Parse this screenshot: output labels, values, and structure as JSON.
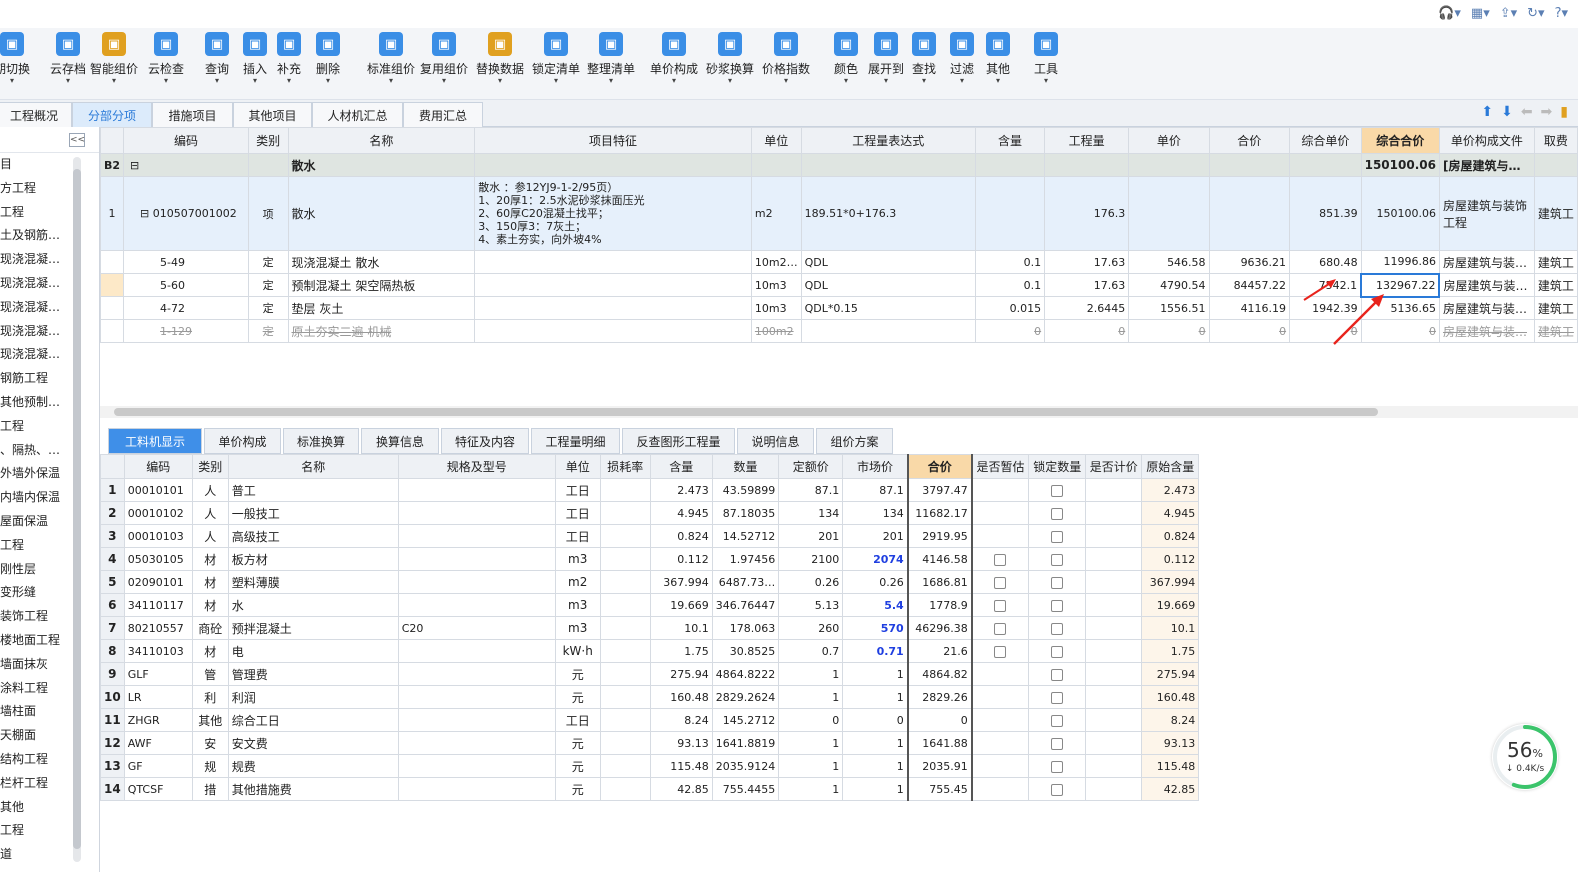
{
  "toolbar": {
    "buttons": [
      {
        "label": "期切换",
        "icon": "switch-icon",
        "color": "#3a8ee6"
      },
      {
        "label": "云存档",
        "icon": "cloud-upload-icon",
        "color": "#3a8ee6"
      },
      {
        "label": "智能组价",
        "icon": "smart-price-icon",
        "color": "#e0a020"
      },
      {
        "label": "云检查",
        "icon": "cloud-check-icon",
        "color": "#3a8ee6"
      },
      {
        "label": "查询",
        "icon": "query-icon",
        "color": "#3a8ee6"
      },
      {
        "label": "插入",
        "icon": "insert-icon",
        "color": "#3a8ee6"
      },
      {
        "label": "补充",
        "icon": "supplement-icon",
        "color": "#3a8ee6"
      },
      {
        "label": "删除",
        "icon": "delete-icon",
        "color": "#3a8ee6"
      },
      {
        "label": "标准组价",
        "icon": "standard-price-icon",
        "color": "#3a8ee6"
      },
      {
        "label": "复用组价",
        "icon": "reuse-price-icon",
        "color": "#3a8ee6"
      },
      {
        "label": "替换数据",
        "icon": "replace-data-icon",
        "color": "#e0a020"
      },
      {
        "label": "锁定清单",
        "icon": "lock-icon",
        "color": "#3a8ee6"
      },
      {
        "label": "整理清单",
        "icon": "organize-list-icon",
        "color": "#3a8ee6"
      },
      {
        "label": "单价构成",
        "icon": "unit-price-icon",
        "color": "#3a8ee6"
      },
      {
        "label": "砂浆换算",
        "icon": "mortar-convert-icon",
        "color": "#3a8ee6"
      },
      {
        "label": "价格指数",
        "icon": "price-index-icon",
        "color": "#3a8ee6"
      },
      {
        "label": "颜色",
        "icon": "color-icon",
        "color": "#3a8ee6"
      },
      {
        "label": "展开到",
        "icon": "expand-to-icon",
        "color": "#3a8ee6"
      },
      {
        "label": "查找",
        "icon": "find-icon",
        "color": "#3a8ee6"
      },
      {
        "label": "过滤",
        "icon": "filter-icon",
        "color": "#3a8ee6"
      },
      {
        "label": "其他",
        "icon": "other-icon",
        "color": "#3a8ee6"
      },
      {
        "label": "工具",
        "icon": "tools-icon",
        "color": "#3a8ee6"
      }
    ]
  },
  "tabs": [
    {
      "label": "工程概况",
      "active": false
    },
    {
      "label": "分部分项",
      "active": true
    },
    {
      "label": "措施项目",
      "active": false
    },
    {
      "label": "其他项目",
      "active": false
    },
    {
      "label": "人材机汇总",
      "active": false
    },
    {
      "label": "费用汇总",
      "active": false
    }
  ],
  "sidebar": {
    "collapse_label": "<<",
    "items": [
      "目",
      "方工程",
      "工程",
      "土及钢筋…",
      "现浇混凝…",
      "现浇混凝…",
      "现浇混凝…",
      "现浇混凝…",
      "现浇混凝…",
      "钢筋工程",
      "其他预制…",
      "工程",
      "、隔热、…",
      "外墙外保温",
      "内墙内保温",
      "屋面保温",
      "工程",
      "刚性层",
      "变形缝",
      "装饰工程",
      "楼地面工程",
      "墙面抹灰",
      "涂料工程",
      "墙柱面",
      "天棚面",
      "结构工程",
      "栏杆工程",
      "其他",
      "工程",
      "道"
    ]
  },
  "upper": {
    "headers": [
      "编码",
      "类别",
      "名称",
      "项目特征",
      "单位",
      "工程量表达式",
      "含量",
      "工程量",
      "单价",
      "合价",
      "综合单价",
      "综合合价",
      "单价构成文件",
      "取费"
    ],
    "rows": [
      {
        "no": "B2",
        "code": "",
        "type": "",
        "name": "散水",
        "feature": "",
        "unit": "",
        "expr": "",
        "content": "",
        "qty": "",
        "price": "",
        "total": "",
        "cprice": "",
        "ctotal": "150100.06",
        "file": "[房屋建筑与…",
        "fee": "",
        "style": "gray"
      },
      {
        "no": "1",
        "code": "010507001002",
        "type": "项",
        "name": "散水",
        "feature": "散水 ：参12YJ9-1-2/95页）\n1、20厚1：2.5水泥砂浆抹面压光\n2、60厚C20混凝土找平；\n3、150厚3：7灰土；\n4、素土夯实，向外坡4%",
        "unit": "m2",
        "expr": "189.51*0+176.3",
        "content": "",
        "qty": "176.3",
        "price": "",
        "total": "",
        "cprice": "851.39",
        "ctotal": "150100.06",
        "file": "房屋建筑与装饰工程",
        "fee": "建筑工",
        "style": "blue"
      },
      {
        "no": "",
        "code": "5-49",
        "type": "定",
        "name": "现浇混凝土 散水",
        "feature": "",
        "unit": "10m2…",
        "expr": "QDL",
        "content": "0.1",
        "qty": "17.63",
        "price": "546.58",
        "total": "9636.21",
        "cprice": "680.48",
        "ctotal": "11996.86",
        "file": "房屋建筑与装…",
        "fee": "建筑工",
        "style": ""
      },
      {
        "no": "",
        "code": "5-60",
        "type": "定",
        "name": "预制混凝土 架空隔热板",
        "feature": "",
        "unit": "10m3",
        "expr": "QDL",
        "content": "0.1",
        "qty": "17.63",
        "price": "4790.54",
        "total": "84457.22",
        "cprice": "7542.1",
        "ctotal": "132967.22",
        "file": "房屋建筑与装…",
        "fee": "建筑工",
        "style": "sel"
      },
      {
        "no": "",
        "code": "4-72",
        "type": "定",
        "name": "垫层 灰土",
        "feature": "",
        "unit": "10m3",
        "expr": "QDL*0.15",
        "content": "0.015",
        "qty": "2.6445",
        "price": "1556.51",
        "total": "4116.19",
        "cprice": "1942.39",
        "ctotal": "5136.65",
        "file": "房屋建筑与装…",
        "fee": "建筑工",
        "style": ""
      },
      {
        "no": "",
        "code": "1-129",
        "type": "定",
        "name": "原土夯实二遍 机械",
        "feature": "",
        "unit": "100m2",
        "expr": "",
        "content": "0",
        "qty": "0",
        "price": "0",
        "total": "0",
        "cprice": "0",
        "ctotal": "0",
        "file": "房屋建筑与装…",
        "fee": "建筑工",
        "style": "strike"
      }
    ]
  },
  "lower_tabs": [
    "工料机显示",
    "单价构成",
    "标准换算",
    "换算信息",
    "特征及内容",
    "工程量明细",
    "反查图形工程量",
    "说明信息",
    "组价方案"
  ],
  "lower": {
    "headers": [
      "编码",
      "类别",
      "名称",
      "规格及型号",
      "单位",
      "损耗率",
      "含量",
      "数量",
      "定额价",
      "市场价",
      "合价",
      "是否暂估",
      "锁定数量",
      "是否计价",
      "原始含量"
    ],
    "rows": [
      {
        "n": "1",
        "code": "00010101",
        "type": "人",
        "name": "普工",
        "spec": "",
        "unit": "工日",
        "loss": "",
        "content": "2.473",
        "qty": "43.59899",
        "quota": "87.1",
        "market": "87.1",
        "mk": false,
        "total": "3797.47",
        "est": false,
        "orig": "2.473"
      },
      {
        "n": "2",
        "code": "00010102",
        "type": "人",
        "name": "一般技工",
        "spec": "",
        "unit": "工日",
        "loss": "",
        "content": "4.945",
        "qty": "87.18035",
        "quota": "134",
        "market": "134",
        "mk": false,
        "total": "11682.17",
        "est": false,
        "orig": "4.945"
      },
      {
        "n": "3",
        "code": "00010103",
        "type": "人",
        "name": "高级技工",
        "spec": "",
        "unit": "工日",
        "loss": "",
        "content": "0.824",
        "qty": "14.52712",
        "quota": "201",
        "market": "201",
        "mk": false,
        "total": "2919.95",
        "est": false,
        "orig": "0.824"
      },
      {
        "n": "4",
        "code": "05030105",
        "type": "材",
        "name": "板方材",
        "spec": "",
        "unit": "m3",
        "loss": "",
        "content": "0.112",
        "qty": "1.97456",
        "quota": "2100",
        "market": "2074",
        "mk": true,
        "total": "4146.58",
        "est": true,
        "orig": "0.112"
      },
      {
        "n": "5",
        "code": "02090101",
        "type": "材",
        "name": "塑料薄膜",
        "spec": "",
        "unit": "m2",
        "loss": "",
        "content": "367.994",
        "qty": "6487.73…",
        "quota": "0.26",
        "market": "0.26",
        "mk": false,
        "total": "1686.81",
        "est": true,
        "orig": "367.994"
      },
      {
        "n": "6",
        "code": "34110117",
        "type": "材",
        "name": "水",
        "spec": "",
        "unit": "m3",
        "loss": "",
        "content": "19.669",
        "qty": "346.76447",
        "quota": "5.13",
        "market": "5.4",
        "mk": true,
        "total": "1778.9",
        "est": true,
        "orig": "19.669"
      },
      {
        "n": "7",
        "code": "80210557",
        "type": "商砼",
        "name": "预拌混凝土",
        "spec": "C20",
        "unit": "m3",
        "loss": "",
        "content": "10.1",
        "qty": "178.063",
        "quota": "260",
        "market": "570",
        "mk": true,
        "total": "46296.38",
        "est": true,
        "orig": "10.1"
      },
      {
        "n": "8",
        "code": "34110103",
        "type": "材",
        "name": "电",
        "spec": "",
        "unit": "kW·h",
        "loss": "",
        "content": "1.75",
        "qty": "30.8525",
        "quota": "0.7",
        "market": "0.71",
        "mk": true,
        "total": "21.6",
        "est": true,
        "orig": "1.75"
      },
      {
        "n": "9",
        "code": "GLF",
        "type": "管",
        "name": "管理费",
        "spec": "",
        "unit": "元",
        "loss": "",
        "content": "275.94",
        "qty": "4864.8222",
        "quota": "1",
        "market": "1",
        "mk": false,
        "total": "4864.82",
        "est": false,
        "orig": "275.94"
      },
      {
        "n": "10",
        "code": "LR",
        "type": "利",
        "name": "利润",
        "spec": "",
        "unit": "元",
        "loss": "",
        "content": "160.48",
        "qty": "2829.2624",
        "quota": "1",
        "market": "1",
        "mk": false,
        "total": "2829.26",
        "est": false,
        "orig": "160.48"
      },
      {
        "n": "11",
        "code": "ZHGR",
        "type": "其他",
        "name": "综合工日",
        "spec": "",
        "unit": "工日",
        "loss": "",
        "content": "8.24",
        "qty": "145.2712",
        "quota": "0",
        "market": "0",
        "mk": false,
        "total": "0",
        "est": false,
        "orig": "8.24"
      },
      {
        "n": "12",
        "code": "AWF",
        "type": "安",
        "name": "安文费",
        "spec": "",
        "unit": "元",
        "loss": "",
        "content": "93.13",
        "qty": "1641.8819",
        "quota": "1",
        "market": "1",
        "mk": false,
        "total": "1641.88",
        "est": false,
        "orig": "93.13"
      },
      {
        "n": "13",
        "code": "GF",
        "type": "规",
        "name": "规费",
        "spec": "",
        "unit": "元",
        "loss": "",
        "content": "115.48",
        "qty": "2035.9124",
        "quota": "1",
        "market": "1",
        "mk": false,
        "total": "2035.91",
        "est": false,
        "orig": "115.48"
      },
      {
        "n": "14",
        "code": "QTCSF",
        "type": "措",
        "name": "其他措施费",
        "spec": "",
        "unit": "元",
        "loss": "",
        "content": "42.85",
        "qty": "755.4455",
        "quota": "1",
        "market": "1",
        "mk": false,
        "total": "755.45",
        "est": false,
        "orig": "42.85"
      }
    ]
  },
  "gauge": {
    "percent": "56",
    "percent_sign": "%",
    "speed": "↓ 0.4K/s",
    "level": 0.56
  }
}
